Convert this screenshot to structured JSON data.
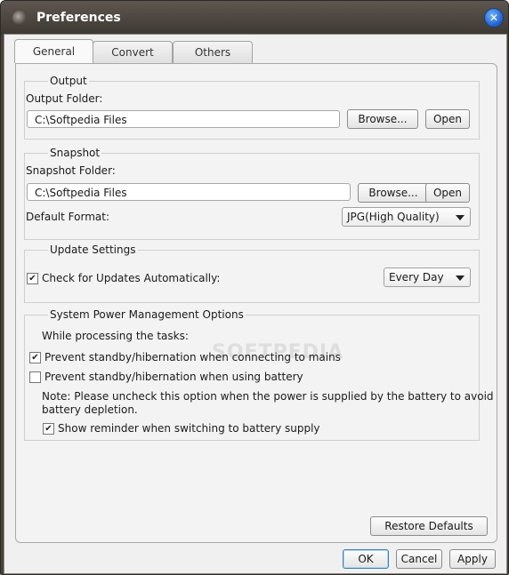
{
  "window": {
    "title": "Preferences",
    "icon": "app-logo-icon",
    "close_icon": "close-icon",
    "close_glyph": "✕"
  },
  "tabs": [
    {
      "label": "General",
      "active": true
    },
    {
      "label": "Convert",
      "active": false
    },
    {
      "label": "Others",
      "active": false
    }
  ],
  "output": {
    "group_title": "Output",
    "folder_label": "Output Folder:",
    "folder_value": "C:\\Softpedia Files",
    "browse_label": "Browse...",
    "open_label": "Open"
  },
  "snapshot": {
    "group_title": "Snapshot",
    "folder_label": "Snapshot Folder:",
    "folder_value": "C:\\Softpedia Files",
    "browse_label": "Browse...",
    "open_label": "Open",
    "format_label": "Default Format:",
    "format_value": "JPG(High Quality)"
  },
  "update": {
    "group_title": "Update Settings",
    "check_label": "Check for Updates Automatically:",
    "check_checked": true,
    "frequency_value": "Every Day"
  },
  "power": {
    "group_title": "System Power Management Options",
    "while_label": "While processing the tasks:",
    "prevent_mains_label": "Prevent standby/hibernation when connecting to mains",
    "prevent_mains_checked": true,
    "prevent_battery_label": "Prevent standby/hibernation when using battery",
    "prevent_battery_checked": false,
    "note_line1": "Note: Please uncheck this option when the power is supplied by the battery to avoid",
    "note_line2": "battery depletion.",
    "reminder_label": "Show reminder when switching to battery supply",
    "reminder_checked": true
  },
  "restore_label": "Restore Defaults",
  "footer": {
    "ok_label": "OK",
    "cancel_label": "Cancel",
    "apply_label": "Apply"
  },
  "check_glyph": "✔",
  "watermark": "SOFTPEDIA"
}
